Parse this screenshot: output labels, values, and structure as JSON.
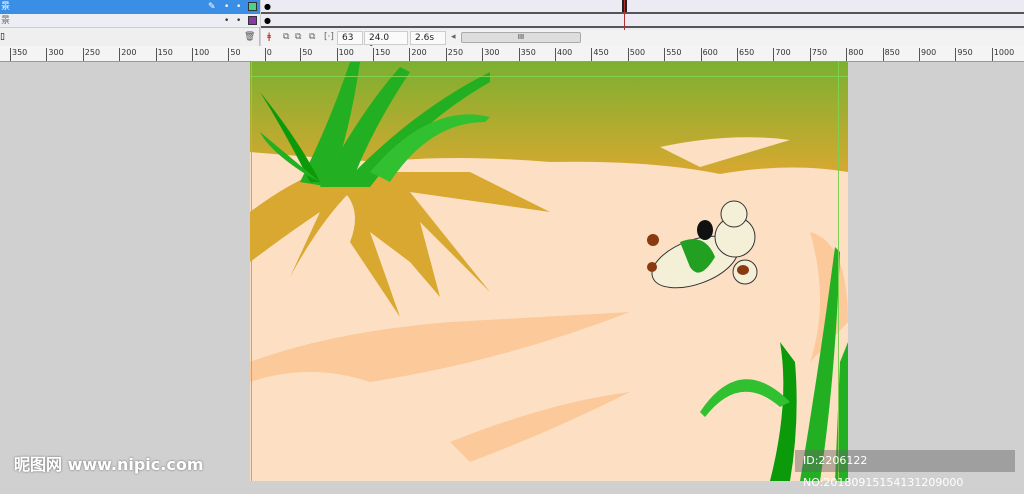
{
  "layers": [
    {
      "name": "景",
      "selected": true,
      "color": "#4fd08a"
    },
    {
      "name": "景",
      "selected": false,
      "color": "#8a3aa8"
    }
  ],
  "timeline": {
    "frame": "63",
    "fps": "24.0 fps",
    "time": "2.6s",
    "scroll_label": "III",
    "playhead_color": "#b03030"
  },
  "ruler": {
    "ticks": [
      "350",
      "300",
      "250",
      "200",
      "150",
      "100",
      "50",
      "0",
      "50",
      "100",
      "150",
      "200",
      "250",
      "300",
      "350",
      "400",
      "450",
      "500",
      "550",
      "600",
      "650",
      "700",
      "750",
      "800",
      "850",
      "900",
      "950",
      "1000"
    ]
  },
  "watermark": {
    "logo": "昵图网 www.nipic.com",
    "id_text": "ID:2206122 NO:20180915154131209000"
  },
  "colors": {
    "sand": "#fde0c4",
    "dune": "#d8a830",
    "grass": "#20b020",
    "stage_bg": "#d0d0d0"
  }
}
